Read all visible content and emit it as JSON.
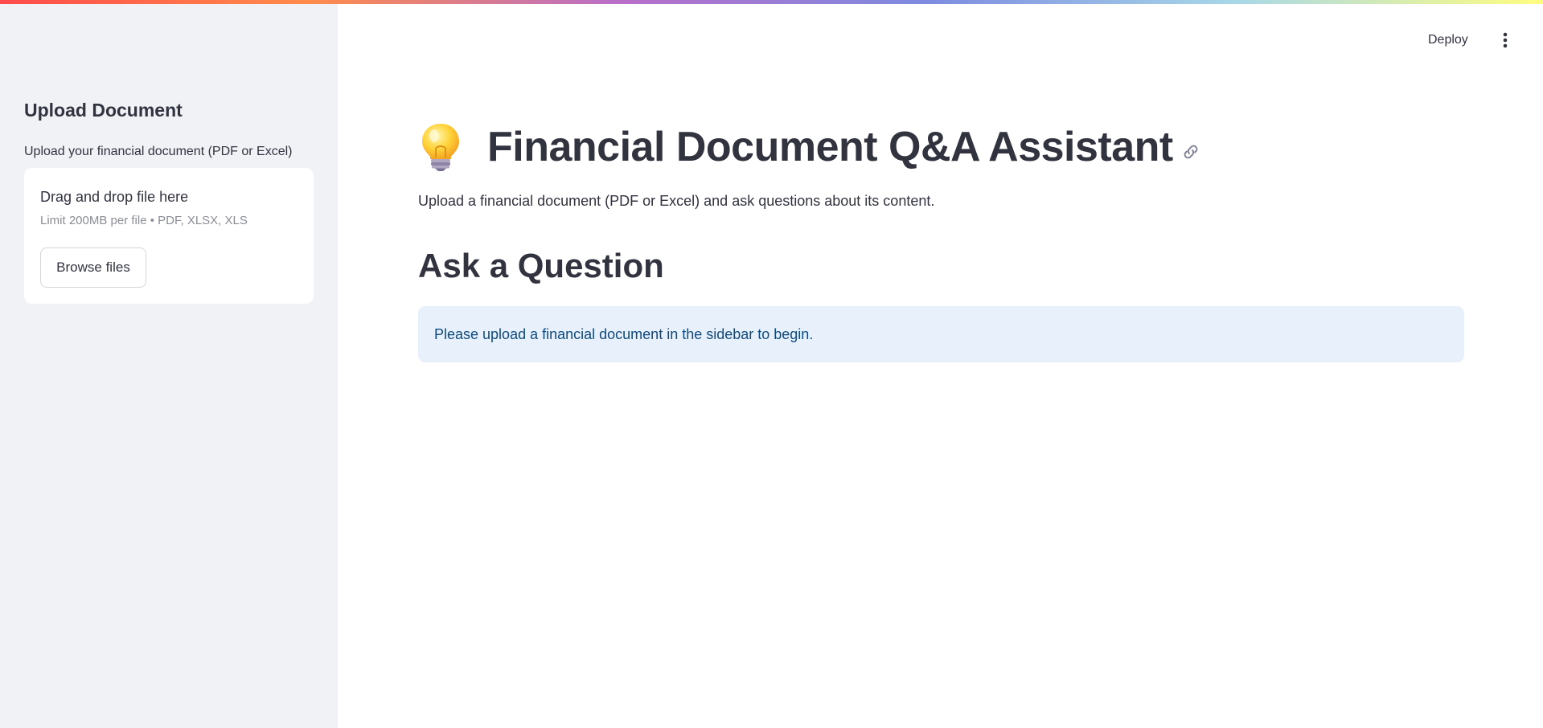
{
  "sidebar": {
    "title": "Upload Document",
    "uploader": {
      "label": "Upload your financial document (PDF or Excel)",
      "drop_instructions": "Drag and drop file here",
      "limit_text": "Limit 200MB per file • PDF, XLSX, XLS",
      "browse_label": "Browse files"
    }
  },
  "header": {
    "deploy_label": "Deploy",
    "menu_icon": "vertical-ellipsis-icon"
  },
  "main": {
    "title_icon": "lightbulb-icon",
    "title": "Financial Document Q&A Assistant",
    "anchor_icon": "link-icon",
    "subtitle": "Upload a financial document (PDF or Excel) and ask questions about its content.",
    "section_heading": "Ask a Question",
    "info_message": "Please upload a financial document in the sidebar to begin."
  },
  "colors": {
    "sidebar_bg": "#f0f2f6",
    "text": "#31333f",
    "info_bg": "#e8f1fb",
    "info_text": "#0e4a7e"
  }
}
